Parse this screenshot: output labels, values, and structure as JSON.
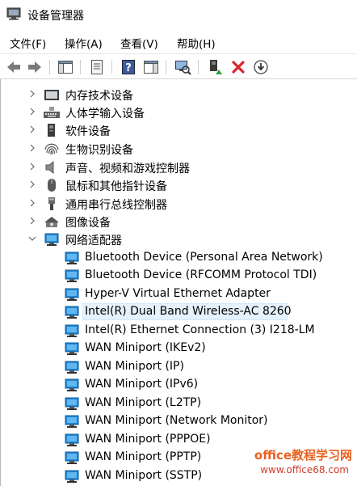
{
  "window": {
    "title": "设备管理器",
    "title_icon": "device-manager-icon"
  },
  "menu": [
    {
      "label": "文件(F)"
    },
    {
      "label": "操作(A)"
    },
    {
      "label": "查看(V)"
    },
    {
      "label": "帮助(H)"
    }
  ],
  "toolbar": [
    {
      "name": "back-icon"
    },
    {
      "name": "forward-icon"
    },
    {
      "name": "console-tree-icon"
    },
    {
      "name": "properties-icon"
    },
    {
      "name": "help-icon"
    },
    {
      "name": "action-pane-icon"
    },
    {
      "name": "scan-hardware-icon"
    },
    {
      "name": "update-driver-icon"
    },
    {
      "name": "uninstall-icon"
    },
    {
      "name": "download-icon"
    }
  ],
  "tree": {
    "categories": [
      {
        "label": "内存技术设备",
        "icon": "memory-device-icon",
        "expanded": false
      },
      {
        "label": "人体学输入设备",
        "icon": "hid-keyboard-icon",
        "expanded": false
      },
      {
        "label": "软件设备",
        "icon": "software-device-icon",
        "expanded": false
      },
      {
        "label": "生物识别设备",
        "icon": "fingerprint-icon",
        "expanded": false
      },
      {
        "label": "声音、视频和游戏控制器",
        "icon": "speaker-icon",
        "expanded": false
      },
      {
        "label": "鼠标和其他指针设备",
        "icon": "mouse-icon",
        "expanded": false
      },
      {
        "label": "通用串行总线控制器",
        "icon": "usb-icon",
        "expanded": false
      },
      {
        "label": "图像设备",
        "icon": "camera-icon",
        "expanded": false
      },
      {
        "label": "网络适配器",
        "icon": "network-adapter-icon",
        "expanded": true
      }
    ],
    "network_devices": [
      {
        "label": "Bluetooth Device (Personal Area Network)",
        "selected": false
      },
      {
        "label": "Bluetooth Device (RFCOMM Protocol TDI)",
        "selected": false
      },
      {
        "label": "Hyper-V Virtual Ethernet Adapter",
        "selected": false
      },
      {
        "label": "Intel(R) Dual Band Wireless-AC 8260",
        "selected": true
      },
      {
        "label": "Intel(R) Ethernet Connection (3) I218-LM",
        "selected": false
      },
      {
        "label": "WAN Miniport (IKEv2)",
        "selected": false
      },
      {
        "label": "WAN Miniport (IP)",
        "selected": false
      },
      {
        "label": "WAN Miniport (IPv6)",
        "selected": false
      },
      {
        "label": "WAN Miniport (L2TP)",
        "selected": false
      },
      {
        "label": "WAN Miniport (Network Monitor)",
        "selected": false
      },
      {
        "label": "WAN Miniport (PPPOE)",
        "selected": false
      },
      {
        "label": "WAN Miniport (PPTP)",
        "selected": false
      },
      {
        "label": "WAN Miniport (SSTP)",
        "selected": false
      }
    ]
  },
  "watermark": {
    "line1": "office教程学习网",
    "line2": "www.office68.com"
  },
  "colors": {
    "selection_bg": "#e5f1fb",
    "selection_border": "#cde8ff",
    "delete_red": "#d9262c",
    "network_blue": "#1e88d6",
    "watermark_orange": "#e8611f"
  }
}
